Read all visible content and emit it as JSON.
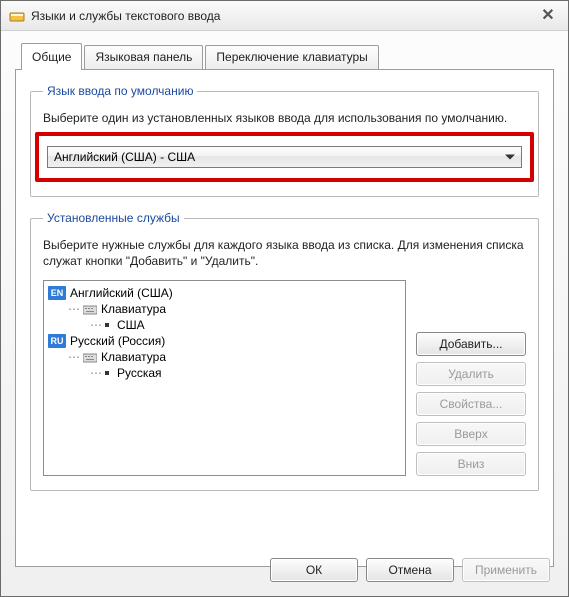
{
  "window": {
    "title": "Языки и службы текстового ввода"
  },
  "tabs": {
    "general": "Общие",
    "langbar": "Языковая панель",
    "switch": "Переключение клавиатуры"
  },
  "defaultGroup": {
    "legend": "Язык ввода по умолчанию",
    "desc": "Выберите один из установленных языков ввода для использования по умолчанию.",
    "selected": "Английский (США) - США"
  },
  "servicesGroup": {
    "legend": "Установленные службы",
    "desc": "Выберите нужные службы для каждого языка ввода из списка. Для изменения списка служат кнопки \"Добавить\" и \"Удалить\"."
  },
  "tree": {
    "en": {
      "badge": "EN",
      "name": "Английский (США)",
      "kb": "Клавиатура",
      "layout": "США"
    },
    "ru": {
      "badge": "RU",
      "name": "Русский (Россия)",
      "kb": "Клавиатура",
      "layout": "Русская"
    }
  },
  "buttons": {
    "add": "Добавить...",
    "remove": "Удалить",
    "props": "Свойства...",
    "up": "Вверх",
    "down": "Вниз"
  },
  "dialog": {
    "ok": "ОК",
    "cancel": "Отмена",
    "apply": "Применить"
  }
}
